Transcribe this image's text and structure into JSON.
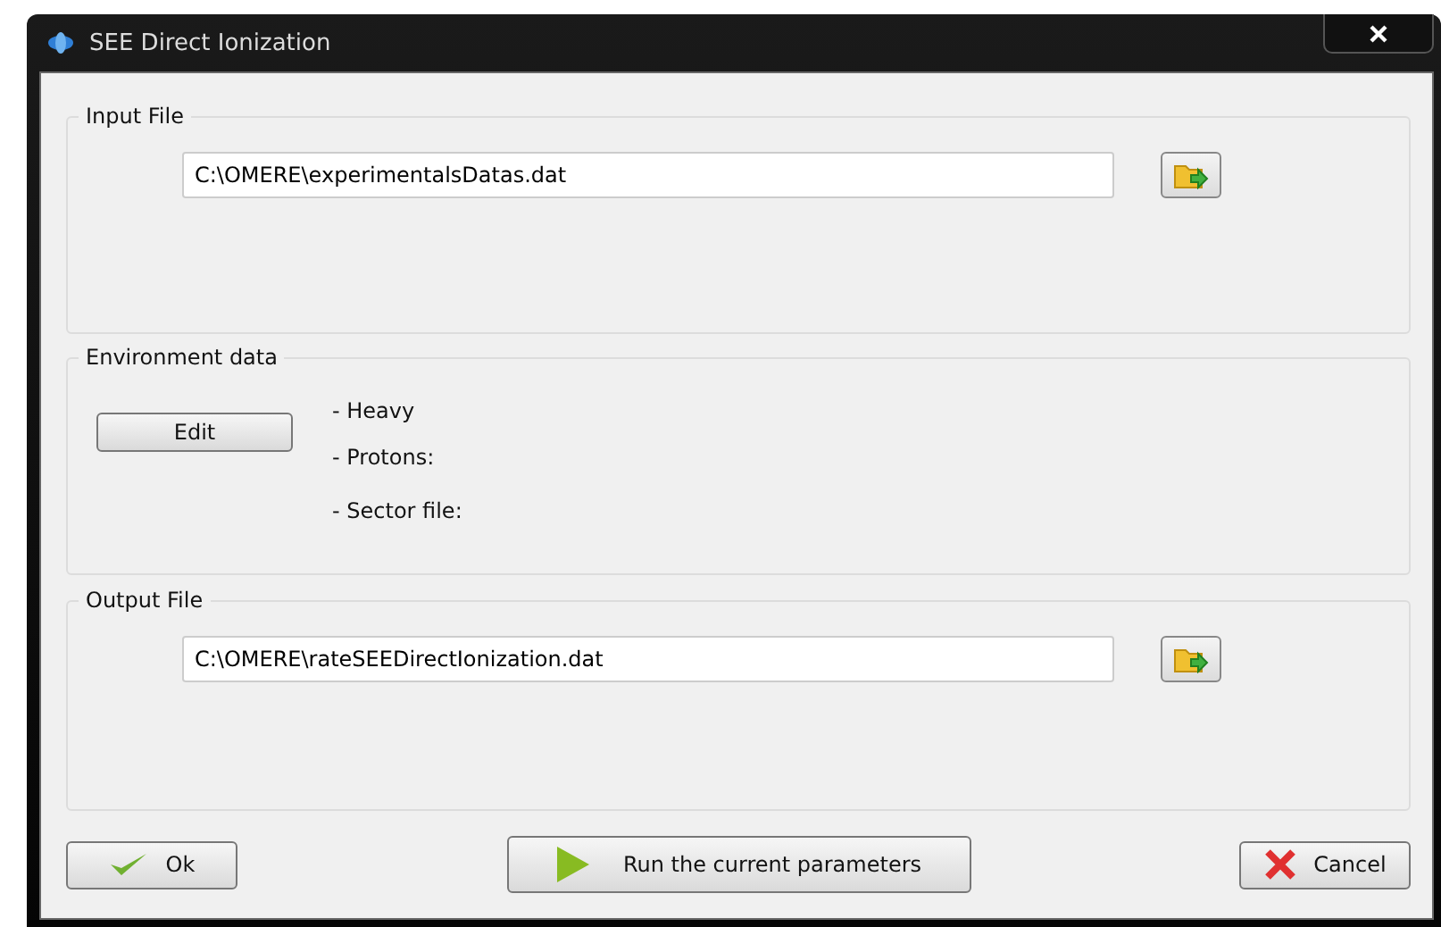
{
  "window": {
    "title": "SEE Direct Ionization"
  },
  "input_file": {
    "title": "Input File",
    "value": "C:\\OMERE\\experimentalsDatas.dat"
  },
  "environment_data": {
    "title": "Environment data",
    "edit_button": "Edit",
    "items": [
      "- Heavy",
      "- Protons:",
      "- Sector file:"
    ]
  },
  "output_file": {
    "title": "Output File",
    "value": "C:\\OMERE\\rateSEEDirectIonization.dat"
  },
  "buttons": [
    {
      "kind": "ok",
      "label": "Ok"
    },
    {
      "kind": "run",
      "label": "Run the current parameters"
    },
    {
      "kind": "cancel",
      "label": "Cancel"
    }
  ]
}
